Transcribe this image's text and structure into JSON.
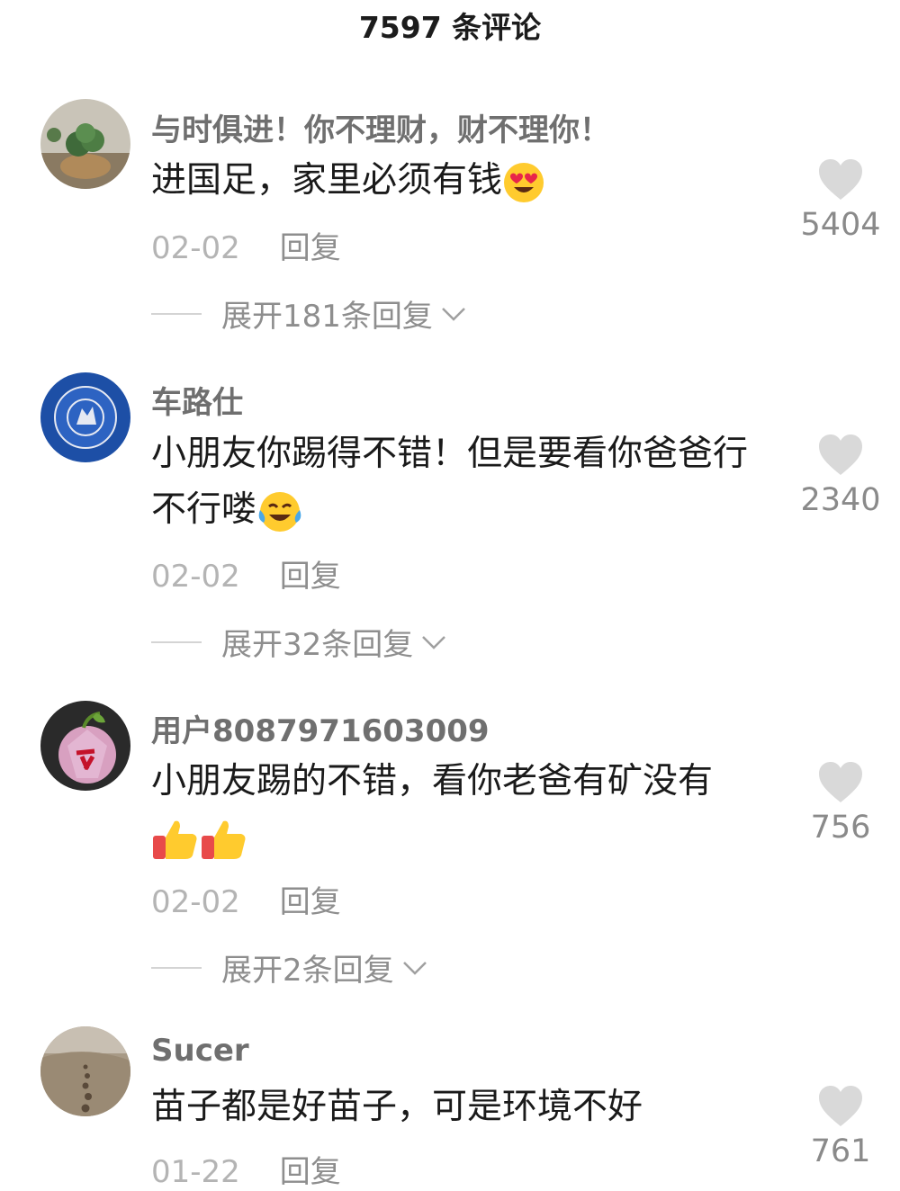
{
  "header": {
    "title": "7597 条评论"
  },
  "comments": [
    {
      "username": "与时俱进！你不理财，财不理你！",
      "text": "进国足，家里必须有钱",
      "emoji": "heart-eyes",
      "date": "02-02",
      "reply_label": "回复",
      "likes": "5404",
      "expand_label": "展开181条回复"
    },
    {
      "username": "车路仕",
      "text": "小朋友你踢得不错！但是要看你爸爸行不行喽",
      "emoji": "tears-of-joy",
      "date": "02-02",
      "reply_label": "回复",
      "likes": "2340",
      "expand_label": "展开32条回复"
    },
    {
      "username": "用户8087971603009",
      "text": "小朋友踢的不错，看你老爸有矿没有",
      "emoji": "thumbs-up x2",
      "date": "02-02",
      "reply_label": "回复",
      "likes": "756",
      "expand_label": "展开2条回复"
    },
    {
      "username": "Sucer",
      "text": "苗子都是好苗子，可是环境不好",
      "date": "01-22",
      "reply_label": "回复",
      "likes": "761"
    }
  ],
  "colors": {
    "username": "#6f6f6f",
    "text": "#1a1a1a",
    "meta": "#b4b4b4",
    "heart": "#d9d9d9"
  }
}
